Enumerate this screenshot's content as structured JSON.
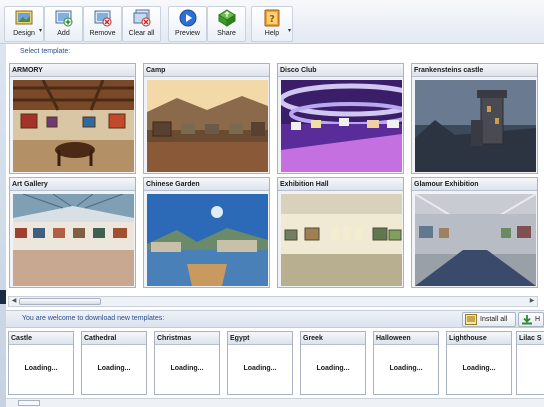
{
  "toolbar": {
    "buttons": [
      {
        "label": "Design",
        "icon": "design-icon",
        "dropdown": true
      },
      {
        "label": "Add",
        "icon": "add-icon"
      },
      {
        "label": "Remove",
        "icon": "remove-icon"
      },
      {
        "label": "Clear all",
        "icon": "clear-all-icon"
      },
      {
        "label": "Preview",
        "icon": "preview-play-icon"
      },
      {
        "label": "Share",
        "icon": "share-icon"
      },
      {
        "label": "Help",
        "icon": "help-book-icon",
        "dropdown": true
      }
    ]
  },
  "templates": {
    "heading": "Select template:",
    "items": [
      {
        "name": "ARMORY",
        "icon": "armory-thumbnail"
      },
      {
        "name": "Camp",
        "icon": "camp-thumbnail"
      },
      {
        "name": "Disco Club",
        "icon": "disco-club-thumbnail"
      },
      {
        "name": "Frankensteins castle",
        "icon": "frankensteins-castle-thumbnail"
      },
      {
        "name": "Art Gallery",
        "icon": "art-gallery-thumbnail"
      },
      {
        "name": "Chinese Garden",
        "icon": "chinese-garden-thumbnail"
      },
      {
        "name": "Exhibition Hall",
        "icon": "exhibition-hall-thumbnail"
      },
      {
        "name": "Glamour Exhibition",
        "icon": "glamour-exhibition-thumbnail"
      }
    ]
  },
  "download": {
    "message": "You are welcome to download new templates:",
    "install_label": "Install all",
    "help_label": "H",
    "loading_text": "Loading...",
    "items": [
      "Castle",
      "Cathedral",
      "Christmas",
      "Egypt",
      "Greek",
      "Halloween",
      "Lighthouse",
      "Lilac S"
    ]
  },
  "colors": {
    "accent_text": "#2b4f8c",
    "panel_border": "#a9b4c2"
  }
}
